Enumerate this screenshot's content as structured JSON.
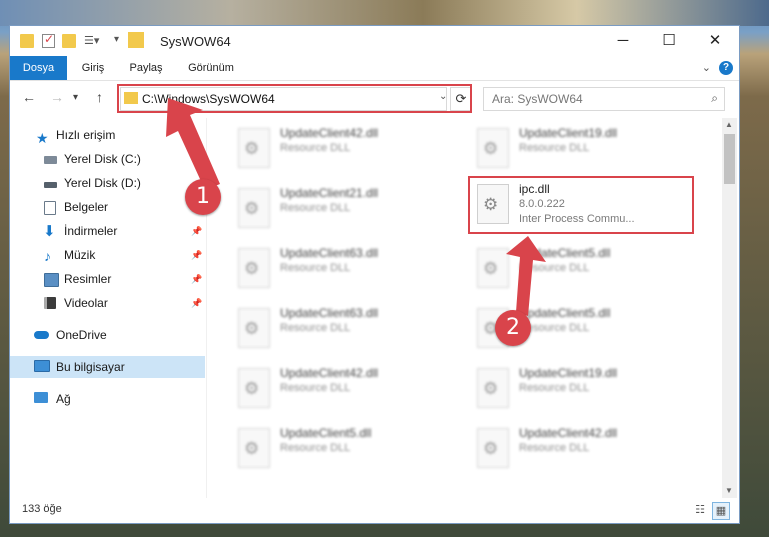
{
  "window": {
    "title": "SysWOW64",
    "minimize_glyph": "─",
    "maximize_glyph": "☐",
    "close_glyph": "✕"
  },
  "ribbon": {
    "tabs": [
      {
        "label": "Dosya",
        "active": true
      },
      {
        "label": "Giriş"
      },
      {
        "label": "Paylaş"
      },
      {
        "label": "Görünüm"
      }
    ],
    "help_glyph": "?"
  },
  "nav": {
    "address": "C:\\Windows\\SysWOW64",
    "search_placeholder": "Ara: SysWOW64"
  },
  "sidebar": {
    "quick_access": "Hızlı erişim",
    "items": [
      {
        "label": "Yerel Disk (C:)",
        "icon": "drive-icon"
      },
      {
        "label": "Yerel Disk (D:)",
        "icon": "drive-icon"
      },
      {
        "label": "Belgeler",
        "icon": "documents-icon"
      },
      {
        "label": "İndirmeler",
        "icon": "downloads-icon"
      },
      {
        "label": "Müzik",
        "icon": "music-icon"
      },
      {
        "label": "Resimler",
        "icon": "pictures-icon"
      },
      {
        "label": "Videolar",
        "icon": "videos-icon"
      }
    ],
    "onedrive": "OneDrive",
    "this_pc": "Bu bilgisayar",
    "network": "Ağ"
  },
  "files": {
    "left": [
      {
        "name": "UpdateClient42.dll",
        "type": "Resource DLL"
      },
      {
        "name": "UpdateClient21.dll",
        "type": "Resource DLL"
      },
      {
        "name": "UpdateClient63.dll",
        "type": "Resource DLL"
      },
      {
        "name": "UpdateClient63.dll",
        "type": "Resource DLL"
      },
      {
        "name": "UpdateClient42.dll",
        "type": "Resource DLL"
      },
      {
        "name": "UpdateClient5.dll",
        "type": "Resource DLL"
      }
    ],
    "right": [
      {
        "name": "UpdateClient19.dll",
        "type": "Resource DLL"
      },
      {
        "name": "ipc.dll",
        "version": "8.0.0.222",
        "type": "Inter Process Commu..."
      },
      {
        "name": "UpdateClient5.dll",
        "type": "Resource DLL"
      },
      {
        "name": "UpdateClient5.dll",
        "type": "Resource DLL"
      },
      {
        "name": "UpdateClient19.dll",
        "type": "Resource DLL"
      },
      {
        "name": "UpdateClient42.dll",
        "type": "Resource DLL"
      }
    ]
  },
  "status": {
    "count": "133 öğe"
  },
  "callouts": {
    "one": "1",
    "two": "2",
    "color": "#d9444b"
  }
}
